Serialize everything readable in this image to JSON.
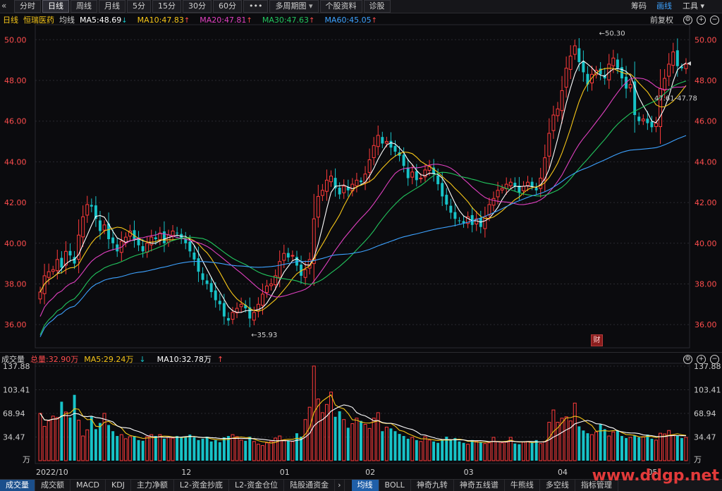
{
  "toolbar": {
    "items": [
      "分时",
      "日线",
      "周线",
      "月线",
      "5分",
      "15分",
      "30分",
      "60分",
      "•••",
      "多周期图",
      "个股资料",
      "诊股"
    ],
    "active": "日线",
    "right": [
      "筹码",
      "画线",
      "工具"
    ],
    "right_active": "画线"
  },
  "header": {
    "period": "日线",
    "stock": "恒瑞医药",
    "indicator": "均线",
    "ma": [
      {
        "label": "MA5:48.69",
        "arrow": "↓",
        "color": "#ffffff"
      },
      {
        "label": "MA10:47.83",
        "arrow": "↑",
        "color": "#f5c518"
      },
      {
        "label": "MA20:47.81",
        "arrow": "↑",
        "color": "#e040c0"
      },
      {
        "label": "MA30:47.63",
        "arrow": "↑",
        "color": "#22c55e"
      },
      {
        "label": "MA60:45.05",
        "arrow": "↑",
        "color": "#3da2ff"
      }
    ],
    "adjust": "前复权"
  },
  "volume_header": {
    "title": "成交量",
    "total": "总量:32.90万",
    "ma5": "MA5:29.24万",
    "ma5_arrow": "↓",
    "ma10": "MA10:32.78万",
    "ma10_arrow": "↑"
  },
  "bottom_tabs": {
    "left": [
      "成交量",
      "成交额",
      "MACD",
      "KDJ",
      "主力净额",
      "L2-资金抄底",
      "L2-资金仓位",
      "陆股通资金"
    ],
    "left_active": "成交量",
    "right": [
      "均线",
      "BOLL",
      "神奇九转",
      "神奇五线谱",
      "牛熊线",
      "多空线",
      "指标管理"
    ],
    "right_active": "均线"
  },
  "badge": "财",
  "watermark": "www.ddgp.net",
  "colors": {
    "up": "#ff3b3b",
    "down": "#17c3c8",
    "ma5": "#ffffff",
    "ma10": "#f5c518",
    "ma20": "#e040c0",
    "ma30": "#22c55e",
    "ma60": "#3da2ff",
    "axis": "#ff4d4d"
  },
  "chart_data": {
    "type": "candlestick",
    "price_axis": {
      "min": 35.0,
      "max": 50.6,
      "ticks": [
        "50.00",
        "48.00",
        "46.00",
        "44.00",
        "42.00",
        "40.00",
        "38.00",
        "36.00"
      ]
    },
    "volume_axis": {
      "max": 137.88,
      "ticks": [
        "137.88",
        "103.41",
        "68.94",
        "34.47"
      ],
      "unit": "万"
    },
    "x_labels": [
      {
        "label": "2022/10",
        "i": 0
      },
      {
        "label": "12",
        "i": 34
      },
      {
        "label": "01",
        "i": 57
      },
      {
        "label": "02",
        "i": 77
      },
      {
        "label": "03",
        "i": 100
      },
      {
        "label": "04",
        "i": 122
      },
      {
        "label": "05",
        "i": 143
      }
    ],
    "annotations": [
      {
        "text": "50.30",
        "i": 130,
        "price": 50.3
      },
      {
        "text": "35.93",
        "i": 49,
        "price": 35.93
      },
      {
        "text": "47.61-47.78",
        "i": 158,
        "price": 47.7
      }
    ],
    "close": [
      37.6,
      38.4,
      38.6,
      38.7,
      39.2,
      38.8,
      39.6,
      39.4,
      39.0,
      40.4,
      41.3,
      41.9,
      41.8,
      41.2,
      40.6,
      40.9,
      40.2,
      40.0,
      39.6,
      40.1,
      40.3,
      40.6,
      40.2,
      39.9,
      39.6,
      40.0,
      40.3,
      40.2,
      40.5,
      40.0,
      40.4,
      40.6,
      40.5,
      40.2,
      40.0,
      39.6,
      39.2,
      38.6,
      38.2,
      38.0,
      37.6,
      37.2,
      37.0,
      36.4,
      36.2,
      36.6,
      36.8,
      37.0,
      36.8,
      36.3,
      36.6,
      37.0,
      37.5,
      37.9,
      38.0,
      38.4,
      39.1,
      39.5,
      39.3,
      39.4,
      38.9,
      38.4,
      38.7,
      39.2,
      41.2,
      42.3,
      42.6,
      43.1,
      43.3,
      42.7,
      42.4,
      42.8,
      42.6,
      42.9,
      43.1,
      43.0,
      43.4,
      44.1,
      44.8,
      45.3,
      44.9,
      45.0,
      44.7,
      44.5,
      44.3,
      43.8,
      43.2,
      43.5,
      43.1,
      43.2,
      43.6,
      43.8,
      43.4,
      42.9,
      42.3,
      41.9,
      41.5,
      41.2,
      41.1,
      41.0,
      41.3,
      40.9,
      41.2,
      40.8,
      41.3,
      41.9,
      42.2,
      42.6,
      42.7,
      42.9,
      43.0,
      42.8,
      42.5,
      42.8,
      43.0,
      42.8,
      42.6,
      43.2,
      44.2,
      45.4,
      46.3,
      46.6,
      47.5,
      48.6,
      49.2,
      49.7,
      48.9,
      48.4,
      47.8,
      48.3,
      48.5,
      48.3,
      48.1,
      48.8,
      49.1,
      48.6,
      48.1,
      47.6,
      47.8,
      46.3,
      46.0,
      46.1,
      45.9,
      45.7,
      45.9,
      47.6,
      48.1,
      48.8,
      49.4,
      48.7,
      48.6,
      48.8
    ],
    "volume": [
      69,
      50,
      58,
      65,
      63,
      86,
      71,
      63,
      96,
      59,
      36,
      45,
      65,
      46,
      55,
      69,
      52,
      43,
      36,
      38,
      32,
      35,
      36,
      30,
      29,
      35,
      38,
      36,
      38,
      32,
      34,
      33,
      36,
      34,
      35,
      38,
      34,
      30,
      32,
      35,
      28,
      30,
      27,
      34,
      36,
      38,
      35,
      30,
      29,
      35,
      28,
      24,
      22,
      26,
      28,
      33,
      36,
      30,
      29,
      28,
      40,
      35,
      60,
      78,
      138,
      90,
      70,
      82,
      100,
      64,
      72,
      60,
      48,
      54,
      62,
      58,
      53,
      47,
      62,
      70,
      43,
      49,
      47,
      43,
      39,
      36,
      32,
      34,
      30,
      28,
      35,
      30,
      28,
      26,
      31,
      35,
      30,
      33,
      28,
      26,
      24,
      30,
      28,
      27,
      25,
      26,
      34,
      28,
      26,
      27,
      34,
      25,
      24,
      27,
      28,
      27,
      30,
      25,
      28,
      56,
      74,
      56,
      62,
      64,
      58,
      84,
      50,
      44,
      40,
      38,
      42,
      53,
      46,
      36,
      42,
      44,
      36,
      33,
      34,
      37,
      34,
      35,
      38,
      32,
      30,
      40,
      39,
      44,
      37,
      36,
      33,
      34
    ],
    "ma5_last": 48.69,
    "ma10_last": 47.83,
    "ma20_last": 47.81,
    "ma30_last": 47.63,
    "ma60_last": 45.05
  }
}
